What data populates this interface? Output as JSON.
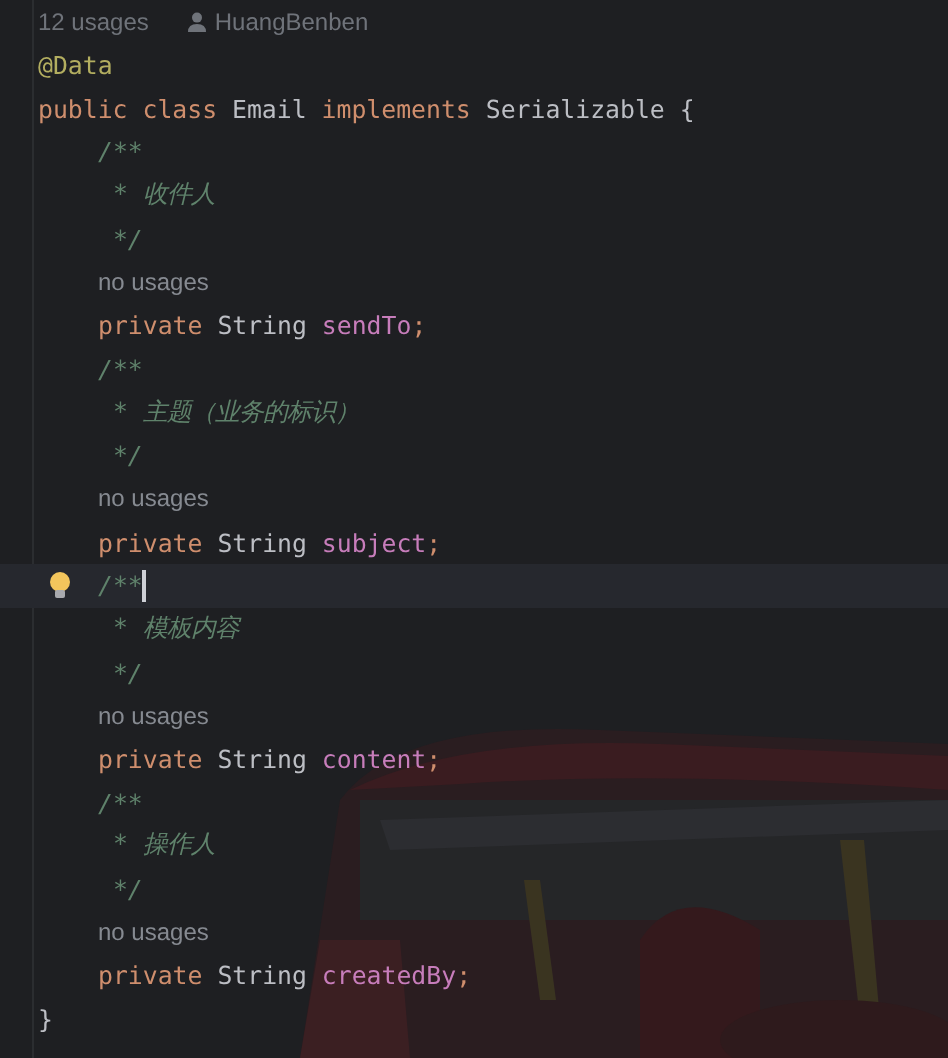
{
  "header_hint": {
    "usages": "12 usages",
    "author": "HuangBenben"
  },
  "lines": [
    {
      "kind": "code",
      "current": false,
      "tokens": [
        {
          "text": "@Data",
          "kind": "annotation"
        }
      ]
    },
    {
      "kind": "code",
      "current": false,
      "tokens": [
        {
          "text": "public",
          "kind": "keyword"
        },
        {
          "text": "class",
          "kind": "keyword"
        },
        {
          "text": "Email",
          "kind": "plain"
        },
        {
          "text": "implements",
          "kind": "keyword"
        },
        {
          "text": "Serializable",
          "kind": "plain"
        },
        {
          "text": "{",
          "kind": "plain"
        }
      ],
      "children": [
        {
          "kind": "code",
          "current": false,
          "tokens": [
            {
              "text": "/**",
              "kind": "doc"
            }
          ]
        },
        {
          "kind": "code",
          "current": false,
          "tokens": [
            {
              "text": " * 收件人",
              "kind": "doc"
            }
          ]
        },
        {
          "kind": "code",
          "current": false,
          "tokens": [
            {
              "text": " */",
              "kind": "doc"
            }
          ]
        },
        {
          "kind": "hint",
          "text": "no usages"
        },
        {
          "kind": "code",
          "current": false,
          "tokens": [
            {
              "text": "private",
              "kind": "keyword"
            },
            {
              "text": "String",
              "kind": "plain"
            },
            {
              "text": "sendTo",
              "kind": "field"
            },
            {
              "text": ";",
              "kind": "punct"
            }
          ]
        },
        {
          "kind": "code",
          "current": false,
          "tokens": [
            {
              "text": "/**",
              "kind": "doc"
            }
          ]
        },
        {
          "kind": "code",
          "current": false,
          "tokens": [
            {
              "text": " * 主题（业务的标识）",
              "kind": "doc"
            }
          ]
        },
        {
          "kind": "code",
          "current": false,
          "tokens": [
            {
              "text": " */",
              "kind": "doc"
            }
          ]
        },
        {
          "kind": "hint",
          "text": "no usages"
        },
        {
          "kind": "code",
          "current": false,
          "tokens": [
            {
              "text": "private",
              "kind": "keyword"
            },
            {
              "text": "String",
              "kind": "plain"
            },
            {
              "text": "subject",
              "kind": "field"
            },
            {
              "text": ";",
              "kind": "punct"
            }
          ]
        },
        {
          "kind": "code",
          "current": true,
          "tokens": [
            {
              "text": "/**",
              "kind": "doc"
            }
          ]
        },
        {
          "kind": "code",
          "current": false,
          "tokens": [
            {
              "text": " * 模板内容",
              "kind": "doc"
            }
          ]
        },
        {
          "kind": "code",
          "current": false,
          "tokens": [
            {
              "text": " */",
              "kind": "doc"
            }
          ]
        },
        {
          "kind": "hint",
          "text": "no usages"
        },
        {
          "kind": "code",
          "current": false,
          "tokens": [
            {
              "text": "private",
              "kind": "keyword"
            },
            {
              "text": "String",
              "kind": "plain"
            },
            {
              "text": "content",
              "kind": "field"
            },
            {
              "text": ";",
              "kind": "punct"
            }
          ]
        },
        {
          "kind": "code",
          "current": false,
          "tokens": [
            {
              "text": "/**",
              "kind": "doc"
            }
          ]
        },
        {
          "kind": "code",
          "current": false,
          "tokens": [
            {
              "text": " * 操作人",
              "kind": "doc"
            }
          ]
        },
        {
          "kind": "code",
          "current": false,
          "tokens": [
            {
              "text": " */",
              "kind": "doc"
            }
          ]
        },
        {
          "kind": "hint",
          "text": "no usages"
        },
        {
          "kind": "code",
          "current": false,
          "tokens": [
            {
              "text": "private",
              "kind": "keyword"
            },
            {
              "text": "String",
              "kind": "plain"
            },
            {
              "text": "createdBy",
              "kind": "field"
            },
            {
              "text": ";",
              "kind": "punct"
            }
          ]
        }
      ]
    },
    {
      "kind": "code",
      "current": false,
      "tokens": [
        {
          "text": "}",
          "kind": "plain"
        }
      ]
    }
  ]
}
